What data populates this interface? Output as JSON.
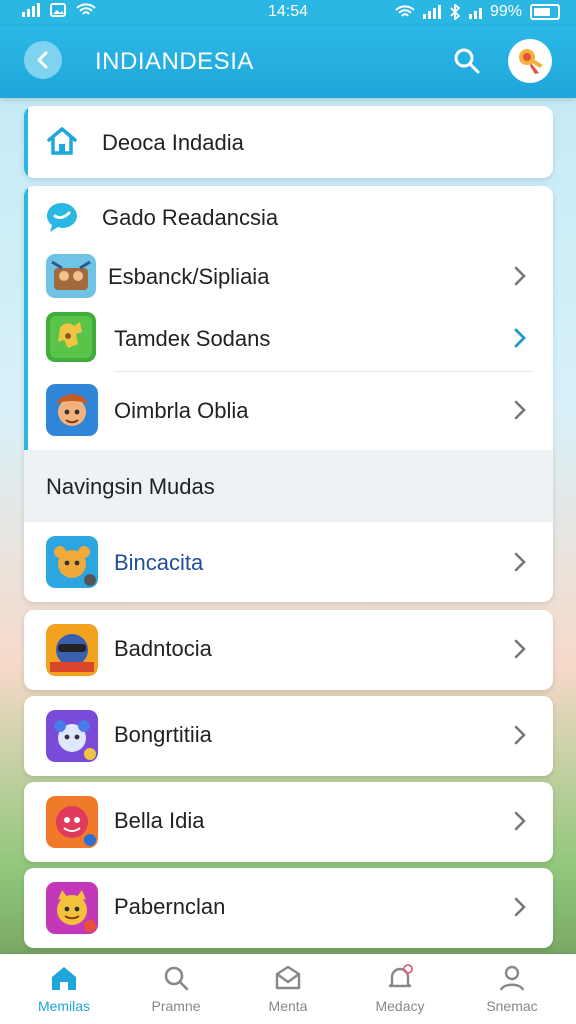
{
  "status_bar": {
    "time": "14:54",
    "battery": "99%"
  },
  "header": {
    "title": "INDIANDESIA"
  },
  "top_item": {
    "label": "Deoca Indadia"
  },
  "list": {
    "items": [
      {
        "label": "Gado Readancsia"
      },
      {
        "label": "Esbanck/Sipliaia"
      },
      {
        "label": "Tamdeк Sodans"
      },
      {
        "label": "Oimbrla Oblia"
      }
    ],
    "section_title": "Navingsin Mudas",
    "section_item": {
      "label": "Bincacita"
    }
  },
  "more_items": [
    {
      "label": "Badntocia"
    },
    {
      "label": "Bongrtitiia"
    },
    {
      "label": "Bella Idia"
    },
    {
      "label": "Pabernclan"
    }
  ],
  "bottom_nav": [
    {
      "label": "Memilas"
    },
    {
      "label": "Pramne"
    },
    {
      "label": "Menta"
    },
    {
      "label": "Medacy"
    },
    {
      "label": "Snemac"
    }
  ],
  "colors": {
    "accent": "#2bb7e3",
    "active_nav": "#1fa6da",
    "chevron_highlight": "#1f9ac9"
  }
}
